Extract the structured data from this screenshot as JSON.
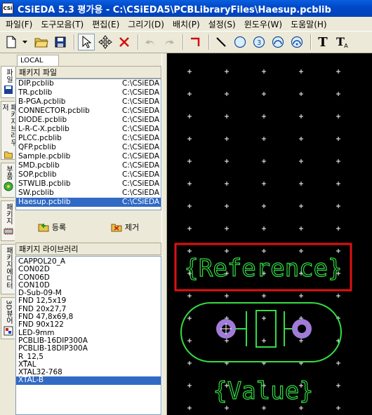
{
  "window": {
    "title": "CSiEDA 5.3 평가용 - C:\\CSiEDA5\\PCBLibraryFiles\\Haesup.pcblib",
    "icon_text": "CSi"
  },
  "menu": [
    "파일(F)",
    "도구모음(T)",
    "편집(E)",
    "그리기(D)",
    "배치(P)",
    "설정(S)",
    "윈도우(W)",
    "도움말(H)"
  ],
  "toolbar": {
    "tools": [
      "new-file-icon",
      "dropdown-arrow-icon",
      "open-folder-icon",
      "save-icon",
      "select-arrow-icon",
      "move-icon",
      "delete-x-icon",
      "undo-icon",
      "redo-icon",
      "corner-line-icon",
      "line-icon",
      "circle-icon",
      "numbered-pad-icon",
      "arc-icon",
      "arc-pad-icon",
      "text-icon",
      "text-alt-icon"
    ],
    "active_tool": "select-arrow-icon"
  },
  "side_tabs": [
    "파일",
    "패키지브라우저",
    "부품",
    "패키지",
    "패키지에디터",
    "3D뷰어"
  ],
  "left_panel": {
    "local_tab": "LOCAL",
    "package_files_header": "패키지 파일",
    "files": [
      {
        "name": "DIP.pcblib",
        "path": "C:\\CSiEDA"
      },
      {
        "name": "TR.pcblib",
        "path": "C:\\CSiEDA"
      },
      {
        "name": "B-PGA.pcblib",
        "path": "C:\\CSiEDA"
      },
      {
        "name": "CONNECTOR.pcblib",
        "path": "C:\\CSiEDA"
      },
      {
        "name": "DIODE.pcblib",
        "path": "C:\\CSiEDA"
      },
      {
        "name": "L-R-C-X.pcblib",
        "path": "C:\\CSiEDA"
      },
      {
        "name": "PLCC.pcblib",
        "path": "C:\\CSiEDA"
      },
      {
        "name": "QFP.pcblib",
        "path": "C:\\CSiEDA"
      },
      {
        "name": "Sample.pcblib",
        "path": "C:\\CSiEDA"
      },
      {
        "name": "SMD.pcblib",
        "path": "C:\\CSiEDA"
      },
      {
        "name": "SOP.pcblib",
        "path": "C:\\CSiEDA"
      },
      {
        "name": "STWLIB.pcblib",
        "path": "C:\\CSiEDA"
      },
      {
        "name": "SW.pcblib",
        "path": "C:\\CSiEDA"
      },
      {
        "name": "Haesup.pcblib",
        "path": "C:\\CSiEDA"
      }
    ],
    "selected_file": "Haesup.pcblib",
    "register_button": "등록",
    "remove_button": "제거",
    "package_library_header": "패키지 라이브러리",
    "packages": [
      "CAPPOL20_A",
      "CON02D",
      "CON06D",
      "CON10D",
      "D-Sub-09-M",
      "FND 12,5x19",
      "FND 20x27,7",
      "FND 47,8x69,8",
      "FND 90x122",
      "LED-9mm",
      "PCBLIB-16DIP300A",
      "PCBLIB-18DIP300A",
      "R_12,5",
      "XTAL",
      "XTAL32-768",
      "XTAL-B"
    ],
    "selected_package": "XTAL-B"
  },
  "canvas": {
    "reference_text": "{Reference}",
    "value_text": "{Value}",
    "colors": {
      "background": "#000000",
      "grid": "#ffffff",
      "silkscreen": "#33dd44",
      "pad": "#a07cd8",
      "highlight_box": "#e01010"
    }
  }
}
